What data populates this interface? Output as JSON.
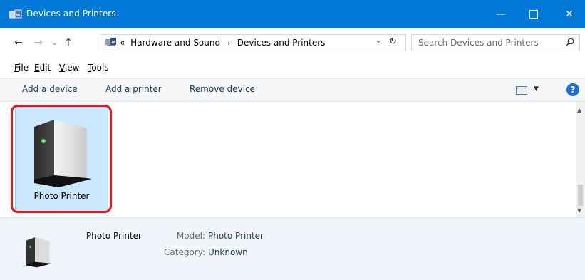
{
  "window": {
    "title": "Devices and Printers",
    "app_icon": "devices-printers-icon",
    "controls": {
      "minimize": "—",
      "close": "✕"
    }
  },
  "nav": {
    "back_icon": "←",
    "forward_icon": "→",
    "recent_icon": "⌄",
    "up_icon": "↑",
    "breadcrumb_prefix": "«",
    "breadcrumbs": [
      "Hardware and Sound",
      "Devices and Printers"
    ],
    "separator": "›",
    "dropdown_icon": "⌄",
    "refresh_icon": "↻",
    "search_placeholder": "Search Devices and Printers"
  },
  "menu": {
    "items": [
      {
        "underline": "F",
        "rest": "ile"
      },
      {
        "underline": "E",
        "rest": "dit"
      },
      {
        "underline": "V",
        "rest": "iew"
      },
      {
        "underline": "T",
        "rest": "ools"
      }
    ]
  },
  "commands": {
    "add_device": "Add a device",
    "add_printer": "Add a printer",
    "remove_device": "Remove device",
    "view_dropdown_icon": "▼",
    "help": "?"
  },
  "devices": [
    {
      "label": "Photo Printer",
      "icon": "printer-device-icon",
      "selected": true
    }
  ],
  "details": {
    "name": "Photo Printer",
    "model_label": "Model:",
    "model_value": "Photo Printer",
    "category_label": "Category:",
    "category_value": "Unknown"
  },
  "colors": {
    "titlebar": "#0078d7",
    "selection": "#cce8ff",
    "highlight_border": "#e8141c",
    "details_bg": "#f1f5fb"
  }
}
